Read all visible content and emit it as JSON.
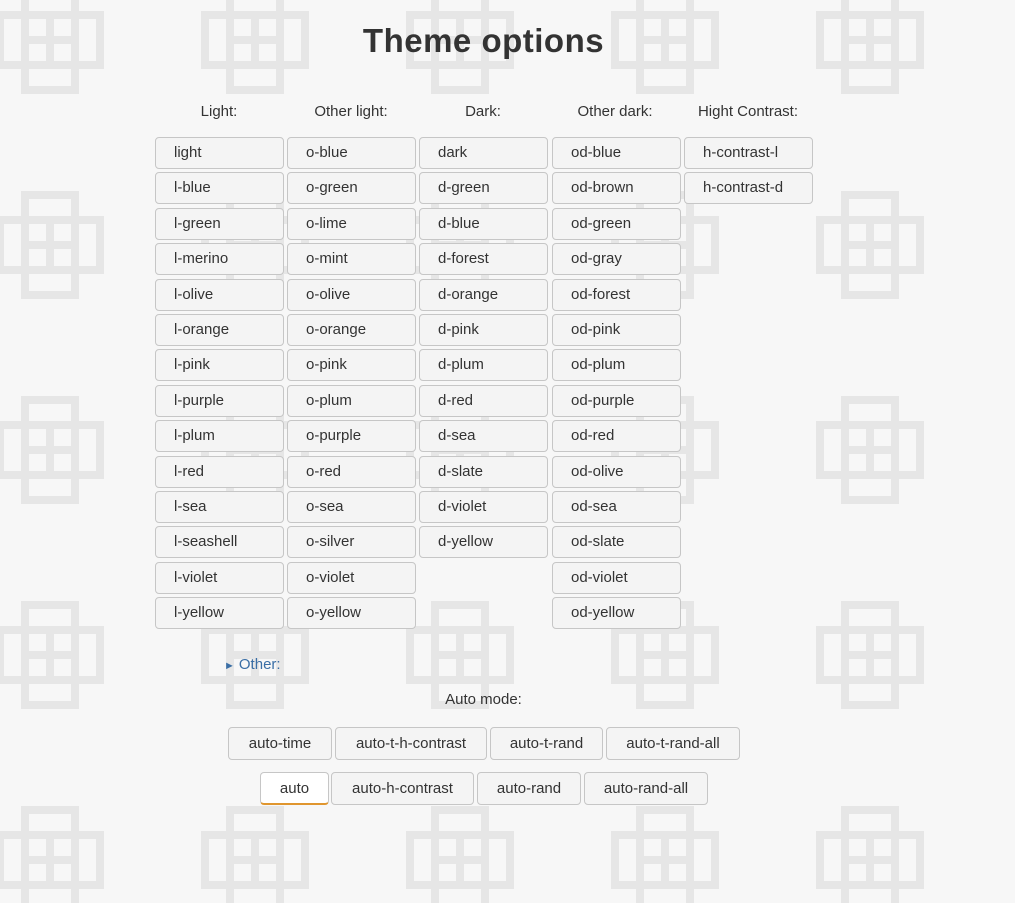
{
  "page": {
    "title": "Theme options"
  },
  "columns": [
    {
      "heading": "Light:",
      "items": [
        "light",
        "l-blue",
        "l-green",
        "l-merino",
        "l-olive",
        "l-orange",
        "l-pink",
        "l-purple",
        "l-plum",
        "l-red",
        "l-sea",
        "l-seashell",
        "l-violet",
        "l-yellow"
      ]
    },
    {
      "heading": "Other light:",
      "items": [
        "o-blue",
        "o-green",
        "o-lime",
        "o-mint",
        "o-olive",
        "o-orange",
        "o-pink",
        "o-plum",
        "o-purple",
        "o-red",
        "o-sea",
        "o-silver",
        "o-violet",
        "o-yellow"
      ]
    },
    {
      "heading": "Dark:",
      "items": [
        "dark",
        "d-green",
        "d-blue",
        "d-forest",
        "d-orange",
        "d-pink",
        "d-plum",
        "d-red",
        "d-sea",
        "d-slate",
        "d-violet",
        "d-yellow"
      ]
    },
    {
      "heading": "Other dark:",
      "items": [
        "od-blue",
        "od-brown",
        "od-green",
        "od-gray",
        "od-forest",
        "od-pink",
        "od-plum",
        "od-purple",
        "od-red",
        "od-olive",
        "od-sea",
        "od-slate",
        "od-violet",
        "od-yellow"
      ]
    },
    {
      "heading": "Hight Contrast:",
      "items": [
        "h-contrast-l",
        "h-contrast-d"
      ]
    }
  ],
  "other": {
    "label": "Other:",
    "icon": "triangle-right-icon"
  },
  "auto": {
    "heading": "Auto mode:",
    "row1": [
      "auto-time",
      "auto-t-h-contrast",
      "auto-t-rand",
      "auto-t-rand-all"
    ],
    "row2": [
      "auto",
      "auto-h-contrast",
      "auto-rand",
      "auto-rand-all"
    ],
    "active": "auto"
  },
  "colors": {
    "accent": "#e0962f",
    "link": "#3a6ea5",
    "button_bg": "#f4f4f4",
    "border": "#c6c6c6"
  }
}
